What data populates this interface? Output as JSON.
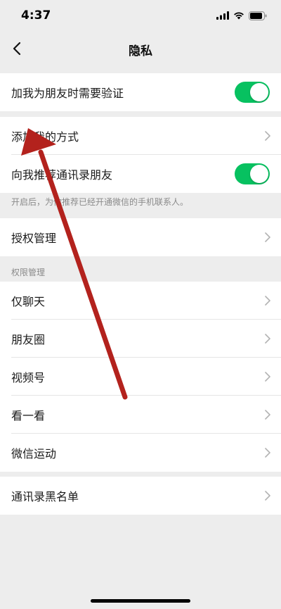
{
  "status_bar": {
    "time": "4:37"
  },
  "nav": {
    "title": "隐私"
  },
  "group1": {
    "verify_label": "加我为朋友时需要验证",
    "verify_on": true
  },
  "group2": {
    "add_methods_label": "添加我的方式",
    "recommend_label": "向我推荐通讯录朋友",
    "recommend_on": true
  },
  "recommend_hint": "开启后，为你推荐已经开通微信的手机联系人。",
  "group3": {
    "auth_label": "授权管理"
  },
  "permissions": {
    "section_title": "权限管理",
    "items": [
      {
        "label": "仅聊天"
      },
      {
        "label": "朋友圈"
      },
      {
        "label": "视频号"
      },
      {
        "label": "看一看"
      },
      {
        "label": "微信运动"
      }
    ]
  },
  "group5": {
    "blacklist_label": "通讯录黑名单"
  },
  "colors": {
    "toggle_on": "#07c160",
    "arrow": "#b3221d",
    "page_bg": "#ededed"
  }
}
